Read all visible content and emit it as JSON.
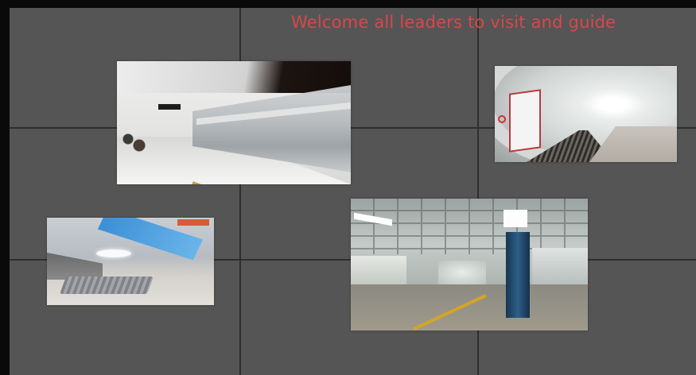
{
  "screen": {
    "welcome_text": "Welcome all leaders to visit and guide",
    "accent_color": "#d9474a",
    "background_color": "#555555"
  },
  "photos": [
    {
      "name": "platform-with-moving-train"
    },
    {
      "name": "tube-tunnel-platform"
    },
    {
      "name": "modern-station-bench"
    },
    {
      "name": "underground-concourse"
    }
  ]
}
